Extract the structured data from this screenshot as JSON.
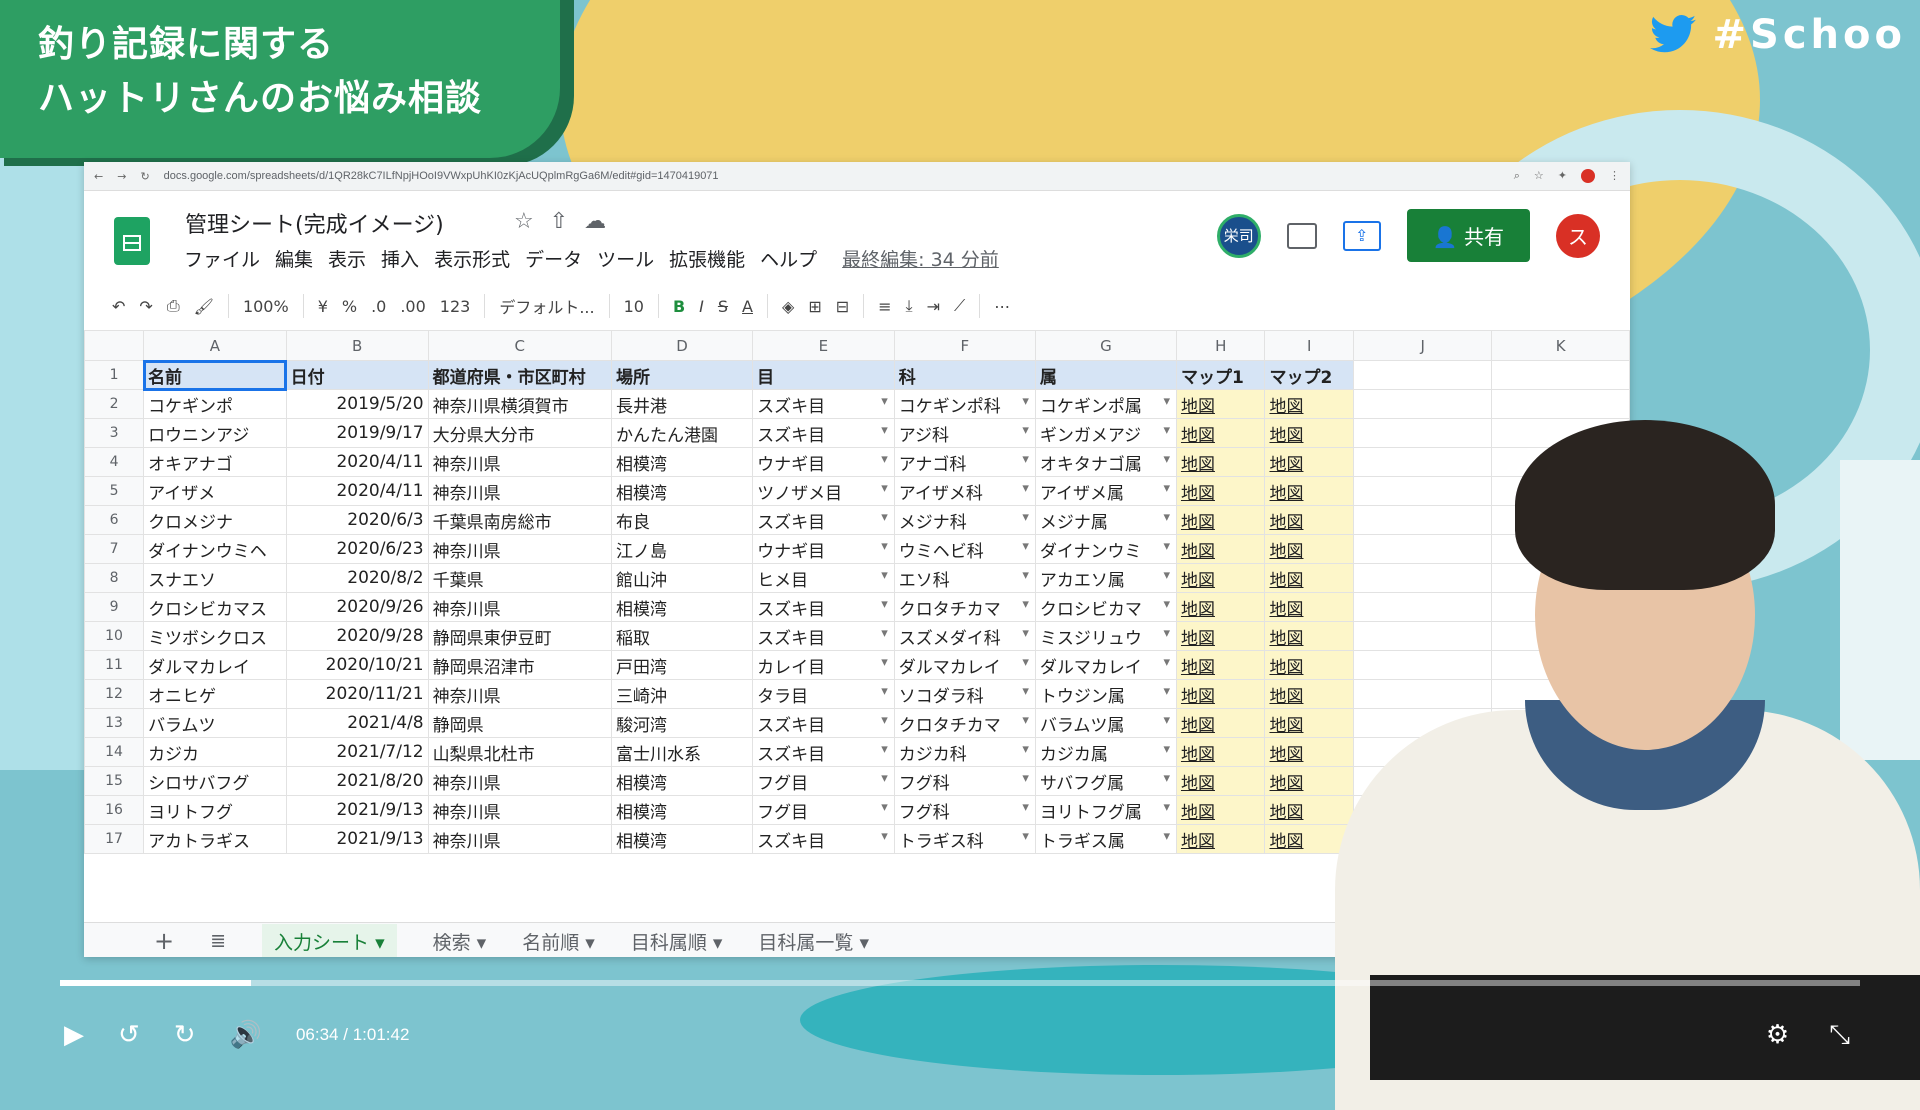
{
  "overlay": {
    "title_lines": [
      "釣り記録に関する",
      "ハットリさんのお悩み相談"
    ],
    "hashtag": "#Schoo"
  },
  "browser": {
    "url": "docs.google.com/spreadsheets/d/1QR28kC7ILfNpjHOoI9VWxpUhKI0zKjAcUQplmRgGa6M/edit#gid=1470419071"
  },
  "sheet": {
    "title": "管理シート(完成イメージ)",
    "menu": [
      "ファイル",
      "編集",
      "表示",
      "挿入",
      "表示形式",
      "データ",
      "ツール",
      "拡張機能",
      "ヘルプ"
    ],
    "last_edit": "最終編集: 34 分前",
    "collaborator": "栄司",
    "share_label": "共有",
    "user_initial": "ス",
    "toolbar": {
      "zoom": "100%",
      "currency": "¥",
      "percent": "%",
      "dec_less": ".0",
      "dec_more": ".00",
      "format": "123",
      "font": "デフォルト...",
      "size": "10",
      "bold": "B",
      "italic": "I",
      "strike": "S",
      "text_color": "A",
      "more": "⋯"
    },
    "col_letters": [
      "A",
      "B",
      "C",
      "D",
      "E",
      "F",
      "G",
      "H",
      "I",
      "J",
      "K"
    ],
    "headers": [
      "名前",
      "日付",
      "都道府県・市区町村",
      "場所",
      "目",
      "科",
      "属",
      "マップ1",
      "マップ2"
    ],
    "rows": [
      [
        "2",
        "コケギンポ",
        "2019/5/20",
        "神奈川県横須賀市",
        "長井港",
        "スズキ目",
        "コケギンポ科",
        "コケギンポ属",
        "地図",
        "地図"
      ],
      [
        "3",
        "ロウニンアジ",
        "2019/9/17",
        "大分県大分市",
        "かんたん港園",
        "スズキ目",
        "アジ科",
        "ギンガメアジ",
        "地図",
        "地図"
      ],
      [
        "4",
        "オキアナゴ",
        "2020/4/11",
        "神奈川県",
        "相模湾",
        "ウナギ目",
        "アナゴ科",
        "オキタナゴ属",
        "地図",
        "地図"
      ],
      [
        "5",
        "アイザメ",
        "2020/4/11",
        "神奈川県",
        "相模湾",
        "ツノザメ目",
        "アイザメ科",
        "アイザメ属",
        "地図",
        "地図"
      ],
      [
        "6",
        "クロメジナ",
        "2020/6/3",
        "千葉県南房総市",
        "布良",
        "スズキ目",
        "メジナ科",
        "メジナ属",
        "地図",
        "地図"
      ],
      [
        "7",
        "ダイナンウミヘ",
        "2020/6/23",
        "神奈川県",
        "江ノ島",
        "ウナギ目",
        "ウミヘビ科",
        "ダイナンウミ",
        "地図",
        "地図"
      ],
      [
        "8",
        "スナエソ",
        "2020/8/2",
        "千葉県",
        "館山沖",
        "ヒメ目",
        "エソ科",
        "アカエソ属",
        "地図",
        "地図"
      ],
      [
        "9",
        "クロシビカマス",
        "2020/9/26",
        "神奈川県",
        "相模湾",
        "スズキ目",
        "クロタチカマ",
        "クロシビカマ",
        "地図",
        "地図"
      ],
      [
        "10",
        "ミツボシクロス",
        "2020/9/28",
        "静岡県東伊豆町",
        "稲取",
        "スズキ目",
        "スズメダイ科",
        "ミスジリュウ",
        "地図",
        "地図"
      ],
      [
        "11",
        "ダルマカレイ",
        "2020/10/21",
        "静岡県沼津市",
        "戸田湾",
        "カレイ目",
        "ダルマカレイ",
        "ダルマカレイ",
        "地図",
        "地図"
      ],
      [
        "12",
        "オニヒゲ",
        "2020/11/21",
        "神奈川県",
        "三崎沖",
        "タラ目",
        "ソコダラ科",
        "トウジン属",
        "地図",
        "地図"
      ],
      [
        "13",
        "バラムツ",
        "2021/4/8",
        "静岡県",
        "駿河湾",
        "スズキ目",
        "クロタチカマ",
        "バラムツ属",
        "地図",
        "地図"
      ],
      [
        "14",
        "カジカ",
        "2021/7/12",
        "山梨県北杜市",
        "富士川水系",
        "スズキ目",
        "カジカ科",
        "カジカ属",
        "地図",
        "地図"
      ],
      [
        "15",
        "シロサバフグ",
        "2021/8/20",
        "神奈川県",
        "相模湾",
        "フグ目",
        "フグ科",
        "サバフグ属",
        "地図",
        "地図"
      ],
      [
        "16",
        "ヨリトフグ",
        "2021/9/13",
        "神奈川県",
        "相模湾",
        "フグ目",
        "フグ科",
        "ヨリトフグ属",
        "地図",
        "地図"
      ],
      [
        "17",
        "アカトラギス",
        "2021/9/13",
        "神奈川県",
        "相模湾",
        "スズキ目",
        "トラギス科",
        "トラギス属",
        "地図",
        "地図"
      ]
    ],
    "tabs": [
      "入力シート",
      "検索",
      "名前順",
      "目科属順",
      "目科属一覧"
    ]
  },
  "player": {
    "current_time": "06:34",
    "separator": "/",
    "duration": "1:01:42",
    "progress": 0.106
  }
}
